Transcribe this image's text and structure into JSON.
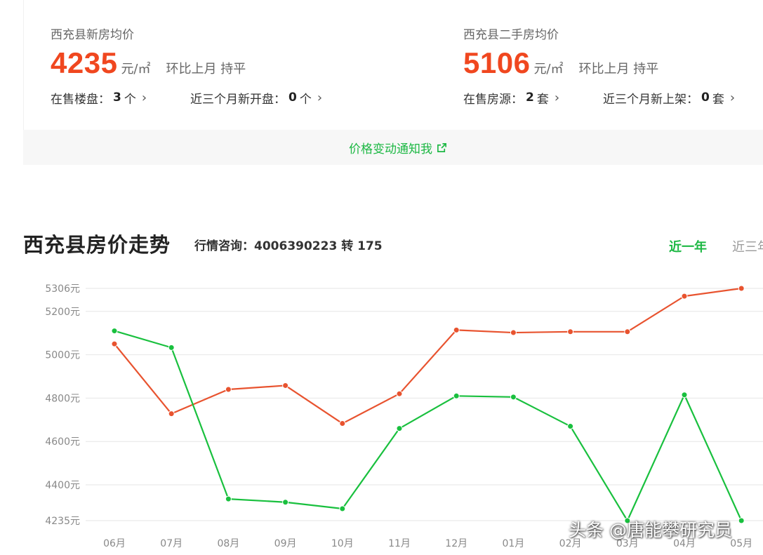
{
  "new_house": {
    "label": "西充县新房均价",
    "price": "4235",
    "unit": "元/㎡",
    "mom": "环比上月 持平",
    "on_sale_label": "在售楼盘：",
    "on_sale_count": "3",
    "on_sale_suffix": "个",
    "recent_label": "近三个月新开盘：",
    "recent_count": "0",
    "recent_suffix": "个"
  },
  "second_hand": {
    "label": "西充县二手房均价",
    "price": "5106",
    "unit": "元/㎡",
    "mom": "环比上月 持平",
    "on_sale_label": "在售房源：",
    "on_sale_count": "2",
    "on_sale_suffix": "套",
    "recent_label": "近三个月新上架：",
    "recent_count": "0",
    "recent_suffix": "套"
  },
  "notify": {
    "label": "价格变动通知我"
  },
  "trend": {
    "title": "西充县房价走势",
    "hotline": "行情咨询：4006390223 转 175",
    "tab_active": "近一年",
    "tab_inactive": "近三年"
  },
  "colors": {
    "accent_green": "#1db844",
    "price_red": "#f0471f",
    "line_orange": "#e8532f",
    "line_green": "#19c03e"
  },
  "chart_data": {
    "type": "line",
    "x": [
      "06月",
      "07月",
      "08月",
      "09月",
      "10月",
      "11月",
      "12月",
      "01月",
      "02月",
      "03月",
      "04月",
      "05月"
    ],
    "ylim": [
      4235,
      5306
    ],
    "yticks": [
      {
        "value": 5306,
        "label": "5306元"
      },
      {
        "value": 5200,
        "label": "5200元"
      },
      {
        "value": 5000,
        "label": "5000元"
      },
      {
        "value": 4800,
        "label": "4800元"
      },
      {
        "value": 4600,
        "label": "4600元"
      },
      {
        "value": 4400,
        "label": "4400元"
      },
      {
        "value": 4235,
        "label": "4235元"
      }
    ],
    "grid": true,
    "series": [
      {
        "color": "#e8532f",
        "values": [
          5050,
          4728,
          4840,
          4858,
          4683,
          4820,
          5114,
          5102,
          5106,
          5106,
          5270,
          5306
        ]
      },
      {
        "color": "#19c03e",
        "values": [
          5110,
          5033,
          4335,
          4320,
          4290,
          4660,
          4810,
          4805,
          4670,
          4235,
          4815,
          4235
        ]
      }
    ]
  },
  "watermark": "头条 @唐能攀研究员"
}
